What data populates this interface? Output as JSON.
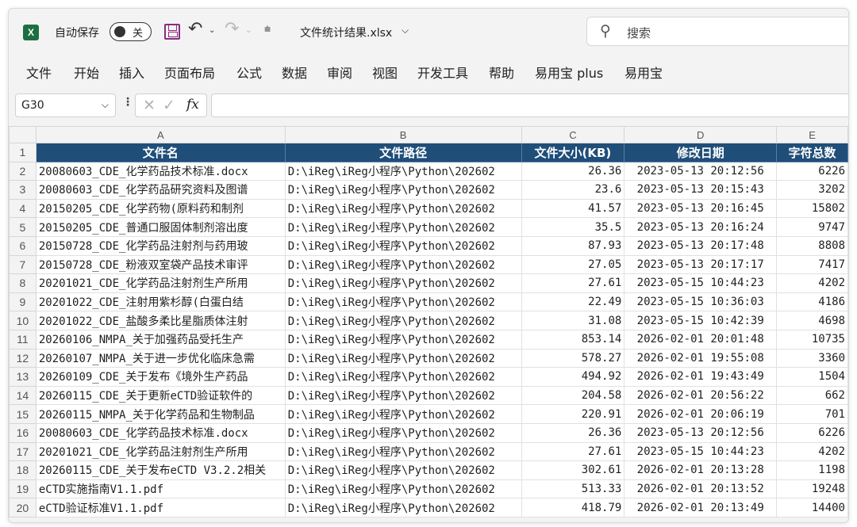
{
  "titlebar": {
    "app_icon": "excel-icon",
    "autosave_label": "自动保存",
    "autosave_state": "关",
    "filename": "文件统计结果.xlsx",
    "filename_caret": "⌵",
    "search_placeholder": "搜索"
  },
  "ribbon_tabs": [
    "文件",
    "开始",
    "插入",
    "页面布局",
    "公式",
    "数据",
    "审阅",
    "视图",
    "开发工具",
    "帮助",
    "易用宝 plus",
    "易用宝"
  ],
  "formula_bar": {
    "name_box": "G30",
    "formula": ""
  },
  "columns": [
    "A",
    "B",
    "C",
    "D",
    "E"
  ],
  "header_row": {
    "num": "1",
    "cells": [
      "文件名",
      "文件路径",
      "文件大小(KB)",
      "修改日期",
      "字符总数"
    ]
  },
  "rows": [
    {
      "num": "2",
      "name": "20080603_CDE_化学药品技术标准.docx",
      "path": "D:\\iReg\\iReg小程序\\Python\\202602",
      "size": "26.36",
      "date": "2023-05-13 20:12:56",
      "chars": "6226"
    },
    {
      "num": "3",
      "name": "20080603_CDE_化学药品研究资料及图谱",
      "path": "D:\\iReg\\iReg小程序\\Python\\202602",
      "size": "23.6",
      "date": "2023-05-13 20:15:43",
      "chars": "3202"
    },
    {
      "num": "4",
      "name": "20150205_CDE_化学药物(原料药和制剂",
      "path": "D:\\iReg\\iReg小程序\\Python\\202602",
      "size": "41.57",
      "date": "2023-05-13 20:16:45",
      "chars": "15802"
    },
    {
      "num": "5",
      "name": "20150205_CDE_普通口服固体制剂溶出度",
      "path": "D:\\iReg\\iReg小程序\\Python\\202602",
      "size": "35.5",
      "date": "2023-05-13 20:16:24",
      "chars": "9747"
    },
    {
      "num": "6",
      "name": "20150728_CDE_化学药品注射剂与药用玻",
      "path": "D:\\iReg\\iReg小程序\\Python\\202602",
      "size": "87.93",
      "date": "2023-05-13 20:17:48",
      "chars": "8808"
    },
    {
      "num": "7",
      "name": "20150728_CDE_粉液双室袋产品技术审评",
      "path": "D:\\iReg\\iReg小程序\\Python\\202602",
      "size": "27.05",
      "date": "2023-05-13 20:17:17",
      "chars": "7417"
    },
    {
      "num": "8",
      "name": "20201021_CDE_化学药品注射剂生产所用",
      "path": "D:\\iReg\\iReg小程序\\Python\\202602",
      "size": "27.61",
      "date": "2023-05-15 10:44:23",
      "chars": "4202"
    },
    {
      "num": "9",
      "name": "20201022_CDE_注射用紫杉醇(白蛋白结",
      "path": "D:\\iReg\\iReg小程序\\Python\\202602",
      "size": "22.49",
      "date": "2023-05-15 10:36:03",
      "chars": "4186"
    },
    {
      "num": "10",
      "name": "20201022_CDE_盐酸多柔比星脂质体注射",
      "path": "D:\\iReg\\iReg小程序\\Python\\202602",
      "size": "31.08",
      "date": "2023-05-15 10:42:39",
      "chars": "4698"
    },
    {
      "num": "11",
      "name": "20260106_NMPA_关于加强药品受托生产",
      "path": "D:\\iReg\\iReg小程序\\Python\\202602",
      "size": "853.14",
      "date": "2026-02-01 20:01:48",
      "chars": "10735"
    },
    {
      "num": "12",
      "name": "20260107_NMPA_关于进一步优化临床急需",
      "path": "D:\\iReg\\iReg小程序\\Python\\202602",
      "size": "578.27",
      "date": "2026-02-01 19:55:08",
      "chars": "3360"
    },
    {
      "num": "13",
      "name": "20260109_CDE_关于发布《境外生产药品",
      "path": "D:\\iReg\\iReg小程序\\Python\\202602",
      "size": "494.92",
      "date": "2026-02-01 19:43:49",
      "chars": "1504"
    },
    {
      "num": "14",
      "name": "20260115_CDE_关于更新eCTD验证软件的",
      "path": "D:\\iReg\\iReg小程序\\Python\\202602",
      "size": "204.58",
      "date": "2026-02-01 20:56:22",
      "chars": "662"
    },
    {
      "num": "15",
      "name": "20260115_NMPA_关于化学药品和生物制品",
      "path": "D:\\iReg\\iReg小程序\\Python\\202602",
      "size": "220.91",
      "date": "2026-02-01 20:06:19",
      "chars": "701"
    },
    {
      "num": "16",
      "name": "20080603_CDE_化学药品技术标准.docx",
      "path": "D:\\iReg\\iReg小程序\\Python\\202602",
      "size": "26.36",
      "date": "2023-05-13 20:12:56",
      "chars": "6226"
    },
    {
      "num": "17",
      "name": "20201021_CDE_化学药品注射剂生产所用",
      "path": "D:\\iReg\\iReg小程序\\Python\\202602",
      "size": "27.61",
      "date": "2023-05-15 10:44:23",
      "chars": "4202"
    },
    {
      "num": "18",
      "name": "20260115_CDE_关于发布eCTD V3.2.2相关",
      "path": "D:\\iReg\\iReg小程序\\Python\\202602",
      "size": "302.61",
      "date": "2026-02-01 20:13:28",
      "chars": "1198"
    },
    {
      "num": "19",
      "name": "eCTD实施指南V1.1.pdf",
      "path": "D:\\iReg\\iReg小程序\\Python\\202602",
      "size": "513.33",
      "date": "2026-02-01 20:13:52",
      "chars": "19248"
    },
    {
      "num": "20",
      "name": "eCTD验证标准V1.1.pdf",
      "path": "D:\\iReg\\iReg小程序\\Python\\202602",
      "size": "418.79",
      "date": "2026-02-01 20:13:49",
      "chars": "14400"
    }
  ],
  "colors": {
    "header_fill": "#1f4e79",
    "header_text": "#ffffff",
    "app_green": "#1d6f42",
    "save_purple": "#8a2b86"
  }
}
